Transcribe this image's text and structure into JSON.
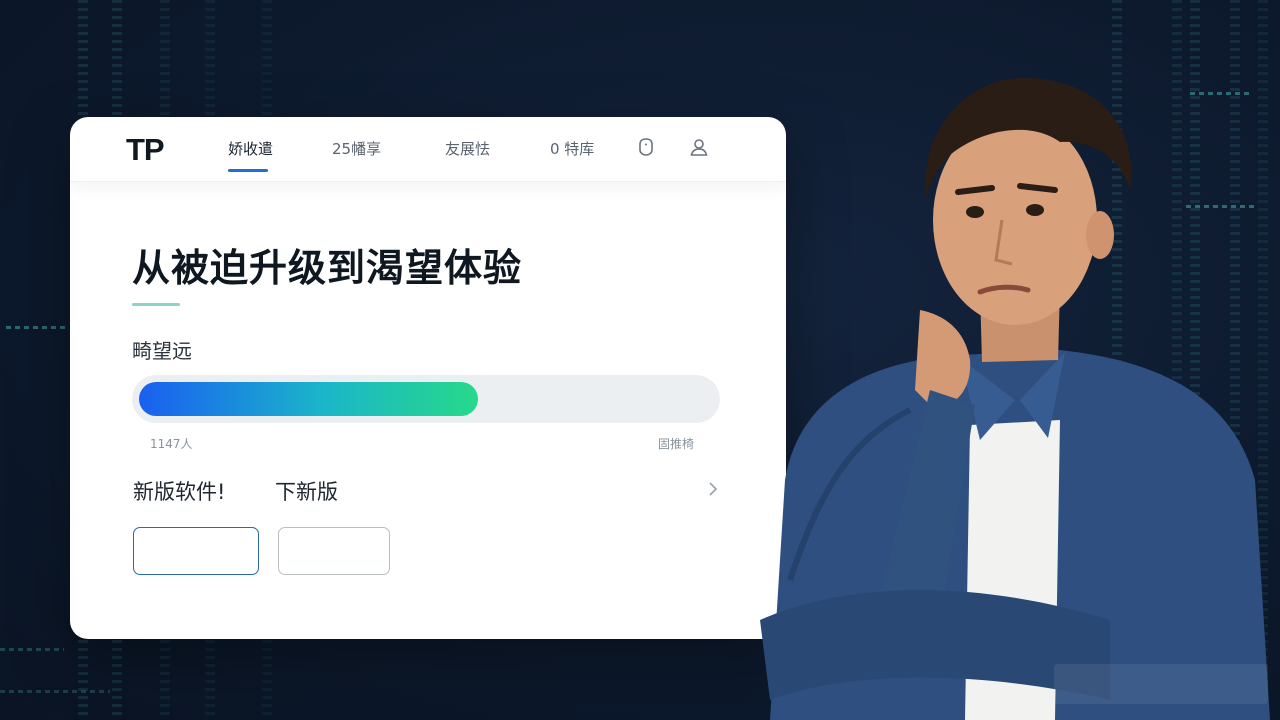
{
  "nav": {
    "logo": "TP",
    "tabs": [
      {
        "label": "娇收遣"
      },
      {
        "label": "25幡享"
      },
      {
        "label": "友展怯"
      },
      {
        "label": "0 特库"
      }
    ]
  },
  "main": {
    "headline": "从被迫升级到渴望体验",
    "progress": {
      "label": "畸望远",
      "fill_percent": 59,
      "left_caption": "1147人",
      "right_caption": "固推椅"
    },
    "options": {
      "left": "新版软件!",
      "right": "下新版"
    },
    "buttons": {
      "primary_label": "",
      "secondary_label": ""
    }
  },
  "icons": {
    "nav_round": "shield-icon",
    "nav_user": "user-icon",
    "row_chevron": "chevron-right-icon"
  },
  "colors": {
    "progress_start": "#1a5ff0",
    "progress_end": "#27d98a",
    "active_tab_underline": "#1f6fd6",
    "accent_rule": "#8fd3c8"
  }
}
